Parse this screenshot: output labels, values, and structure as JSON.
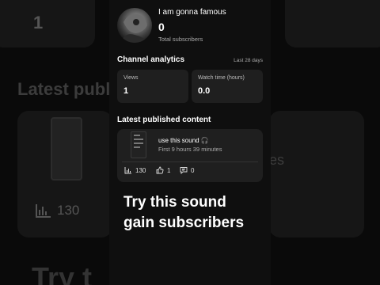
{
  "background": {
    "count": "1",
    "heading": "Latest publ",
    "suffix": "es",
    "views": "130",
    "overlay": "Try t"
  },
  "channel": {
    "name": "I am gonna famous",
    "subscriber_count": "0",
    "subscriber_label": "Total subscribers"
  },
  "analytics": {
    "title": "Channel analytics",
    "period": "Last 28 days",
    "views_label": "Views",
    "views_value": "1",
    "watch_label": "Watch time (hours)",
    "watch_value": "0.0"
  },
  "latest": {
    "title": "Latest published content",
    "video_title": "use this sound 🎧",
    "video_meta": "First 9 hours 39 minutes",
    "views": "130",
    "likes": "1",
    "comments": "0"
  },
  "overlay_text": {
    "line1": "Try this sound",
    "line2": "gain subscribers"
  },
  "colors": {
    "background": "#0f0f0f",
    "card": "#1f1f1f",
    "muted_text": "#aaaaaa"
  }
}
